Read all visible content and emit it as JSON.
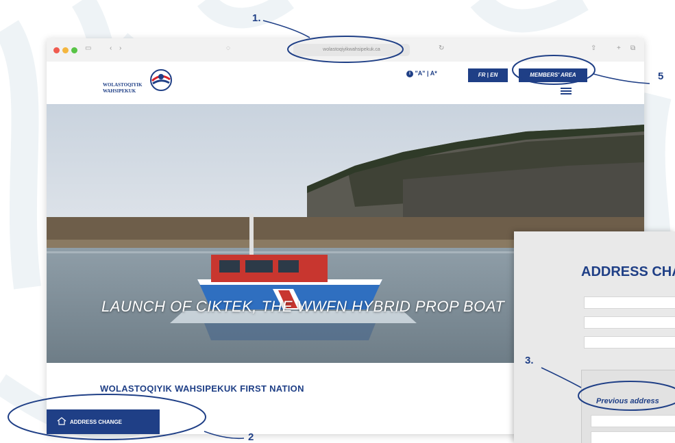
{
  "browser": {
    "url": "wolastoqiyikwahsipekuk.ca"
  },
  "header": {
    "logo_line1": "WOLASTOQIYIK",
    "logo_line2": "WAHSIPEKUK",
    "accessibility_text": "\"A\" | A*",
    "lang_label": "FR | EN",
    "members_label": "MEMBERS' AREA"
  },
  "hero": {
    "title": "LAUNCH OF CIKTEK, THE WWFN HYBRID PROP BOAT"
  },
  "content": {
    "nation_title": "WOLASTOQIYIK WAHSIPEKUK FIRST NATION",
    "address_button": "ADDRESS CHANGE"
  },
  "form": {
    "title": "ADDRESS CHANGE",
    "previous_address_label": "Previous address"
  },
  "annotations": {
    "n1": "1.",
    "n2": "2",
    "n3": "3.",
    "n5": "5"
  },
  "colors": {
    "brand_blue": "#1f3f86",
    "annotation_blue": "#1f3f86"
  },
  "icons": {
    "home": "home-icon",
    "menu": "hamburger-menu-icon",
    "info": "info-icon"
  }
}
